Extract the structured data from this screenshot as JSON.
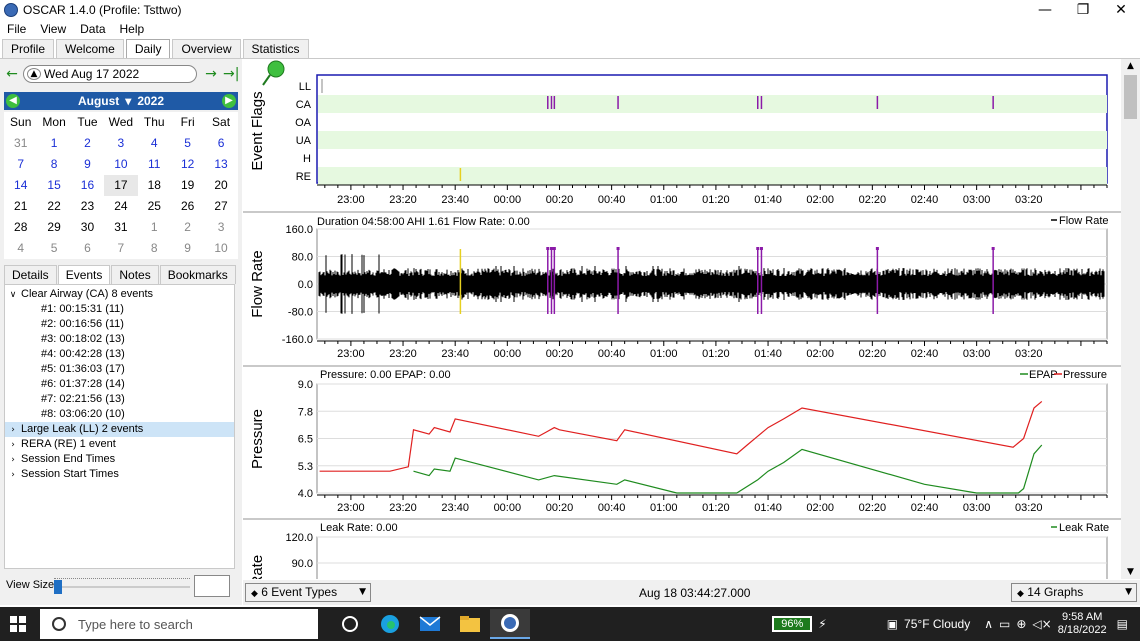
{
  "window": {
    "title": "OSCAR 1.4.0 (Profile: Tsttwo)",
    "minimize": "—",
    "maximize": "❐",
    "close": "✕"
  },
  "menu": [
    "File",
    "View",
    "Data",
    "Help"
  ],
  "main_tabs": [
    "Profile",
    "Welcome",
    "Daily",
    "Overview",
    "Statistics"
  ],
  "date_nav": {
    "date": "Wed Aug 17 2022"
  },
  "calendar": {
    "month": "August",
    "year": "2022",
    "dow": [
      "Sun",
      "Mon",
      "Tue",
      "Wed",
      "Thu",
      "Fri",
      "Sat"
    ],
    "weeks": [
      [
        "31",
        "1",
        "2",
        "3",
        "4",
        "5",
        "6"
      ],
      [
        "7",
        "8",
        "9",
        "10",
        "11",
        "12",
        "13"
      ],
      [
        "14",
        "15",
        "16",
        "17",
        "18",
        "19",
        "20"
      ],
      [
        "21",
        "22",
        "23",
        "24",
        "25",
        "26",
        "27"
      ],
      [
        "28",
        "29",
        "30",
        "31",
        "1",
        "2",
        "3"
      ],
      [
        "4",
        "5",
        "6",
        "7",
        "8",
        "9",
        "10"
      ]
    ]
  },
  "sub_tabs": [
    "Details",
    "Events",
    "Notes",
    "Bookmarks"
  ],
  "events": {
    "groups": [
      {
        "label": "Clear Airway (CA) 8 events",
        "expanded": true,
        "items": [
          "#1: 00:15:31 (11)",
          "#2: 00:16:56 (11)",
          "#3: 00:18:02 (13)",
          "#4: 00:42:28 (13)",
          "#5: 01:36:03 (17)",
          "#6: 01:37:28 (14)",
          "#7: 02:21:56 (13)",
          "#8: 03:06:20 (10)"
        ]
      },
      {
        "label": "Large Leak (LL) 2 events",
        "expanded": false,
        "selected": true,
        "items": []
      },
      {
        "label": "RERA (RE) 1 event",
        "expanded": false,
        "items": []
      },
      {
        "label": "Session End Times",
        "expanded": false,
        "items": []
      },
      {
        "label": "Session Start Times",
        "expanded": false,
        "items": []
      }
    ]
  },
  "view_size_label": "View Size",
  "time_axis": [
    "23:00",
    "23:20",
    "23:40",
    "00:00",
    "00:20",
    "00:40",
    "01:00",
    "01:20",
    "01:40",
    "02:00",
    "02:20",
    "02:40",
    "03:00",
    "03:20"
  ],
  "flags_chart": {
    "ylabel": "Event Flags",
    "rows": [
      "LL",
      "CA",
      "OA",
      "UA",
      "H",
      "RE"
    ],
    "ca_events": [
      "00:15:31",
      "00:16:56",
      "00:18:02",
      "00:42:28",
      "01:36:03",
      "01:37:28",
      "02:21:56",
      "03:06:20"
    ],
    "re_events": [
      "23:42:00"
    ]
  },
  "flow_chart": {
    "ylabel": "Flow Rate",
    "header": "Duration 04:58:00 AHI 1.61 Flow Rate: 0.00",
    "legend": "Flow Rate",
    "yticks": [
      "160.0",
      "80.0",
      "0.0",
      "-80.0",
      "-160.0"
    ]
  },
  "pressure_chart": {
    "ylabel": "Pressure",
    "header": "Pressure: 0.00 EPAP: 0.00",
    "legend": [
      "EPAP",
      "Pressure"
    ],
    "yticks": [
      "9.0",
      "7.8",
      "6.5",
      "5.3",
      "4.0"
    ]
  },
  "leak_chart": {
    "ylabel": "Leak Rate",
    "header": "Leak Rate: 0.00",
    "legend": "Leak Rate",
    "yticks": [
      "120.0",
      "90.0"
    ]
  },
  "bottom_bar": {
    "event_types": "6 Event Types",
    "time": "Aug 18 03:44:27.000",
    "graphs": "14 Graphs"
  },
  "taskbar": {
    "search_placeholder": "Type here to search",
    "battery": "96%",
    "weather": "75°F  Cloudy",
    "time": "9:58 AM",
    "date": "8/18/2022"
  },
  "colors": {
    "pressure": "#e02020",
    "epap": "#1f8b1f",
    "ca": "#8b1aa8",
    "re": "#e6d020",
    "cal_header": "#1f5aa6",
    "flag_band": "#e6f9e0"
  }
}
